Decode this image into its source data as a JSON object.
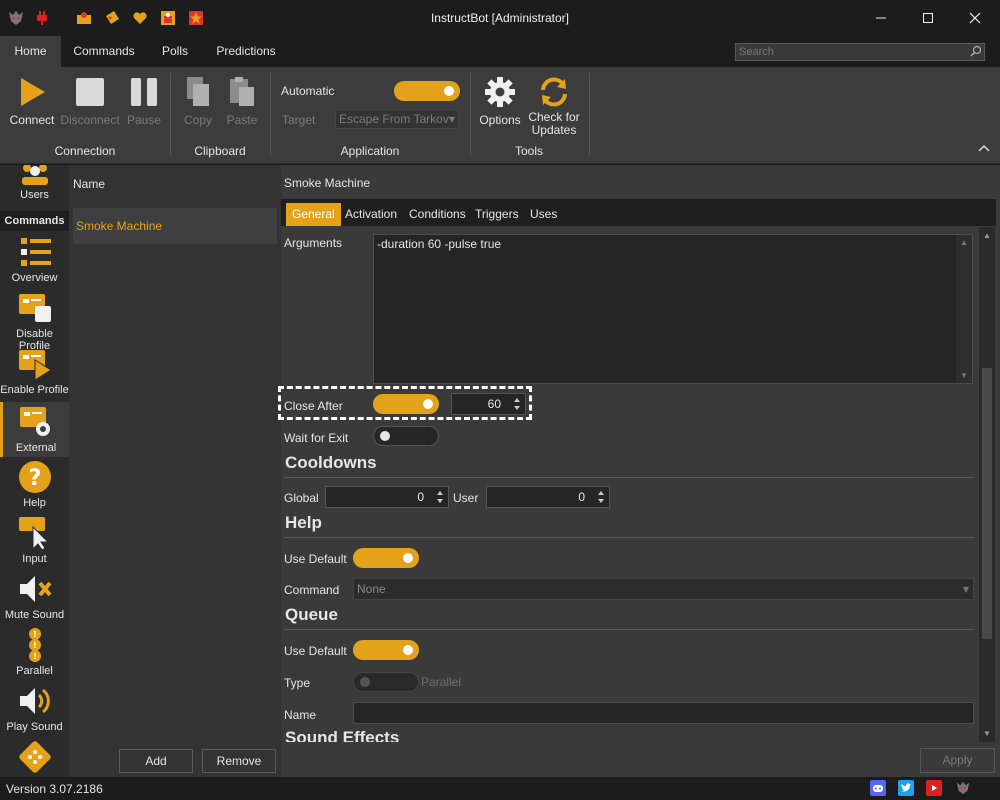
{
  "window": {
    "title": "InstructBot [Administrator]"
  },
  "menu": {
    "tabs": [
      "Home",
      "Commands",
      "Polls",
      "Predictions"
    ],
    "search_placeholder": "Search"
  },
  "ribbon": {
    "connect": "Connect",
    "disconnect": "Disconnect",
    "pause": "Pause",
    "copy": "Copy",
    "paste": "Paste",
    "automatic_label": "Automatic",
    "target_label": "Target",
    "target_value": "Escape From Tarkov",
    "options": "Options",
    "check_updates_line1": "Check for",
    "check_updates_line2": "Updates",
    "groups": {
      "connection": "Connection",
      "clipboard": "Clipboard",
      "application": "Application",
      "tools": "Tools"
    }
  },
  "sidebar": {
    "section": "Commands",
    "items": [
      "Users",
      "Overview",
      "Disable Profile",
      "Enable Profile",
      "External",
      "Help",
      "Input",
      "Mute Sound",
      "Parallel",
      "Play Sound"
    ]
  },
  "list": {
    "header": "Name",
    "rows": [
      "Smoke Machine"
    ],
    "add": "Add",
    "remove": "Remove"
  },
  "detail": {
    "title": "Smoke Machine",
    "tabs": [
      "General",
      "Activation",
      "Conditions",
      "Triggers",
      "Uses"
    ],
    "arguments_label": "Arguments",
    "arguments_value": "-duration 60 -pulse true",
    "close_after_label": "Close After",
    "close_after_value": "60",
    "wait_for_exit_label": "Wait for Exit",
    "cooldowns_header": "Cooldowns",
    "global_label": "Global",
    "global_value": "0",
    "user_label": "User",
    "user_value": "0",
    "help_header": "Help",
    "use_default_label": "Use Default",
    "command_label": "Command",
    "command_value": "None",
    "queue_header": "Queue",
    "queue_use_default_label": "Use Default",
    "type_label": "Type",
    "type_value": "Parallel",
    "name_label": "Name",
    "sound_header": "Sound Effects",
    "apply": "Apply"
  },
  "status": {
    "version": "Version 3.07.2186"
  },
  "colors": {
    "accent": "#e3a21a",
    "background": "#3a3a3a"
  }
}
